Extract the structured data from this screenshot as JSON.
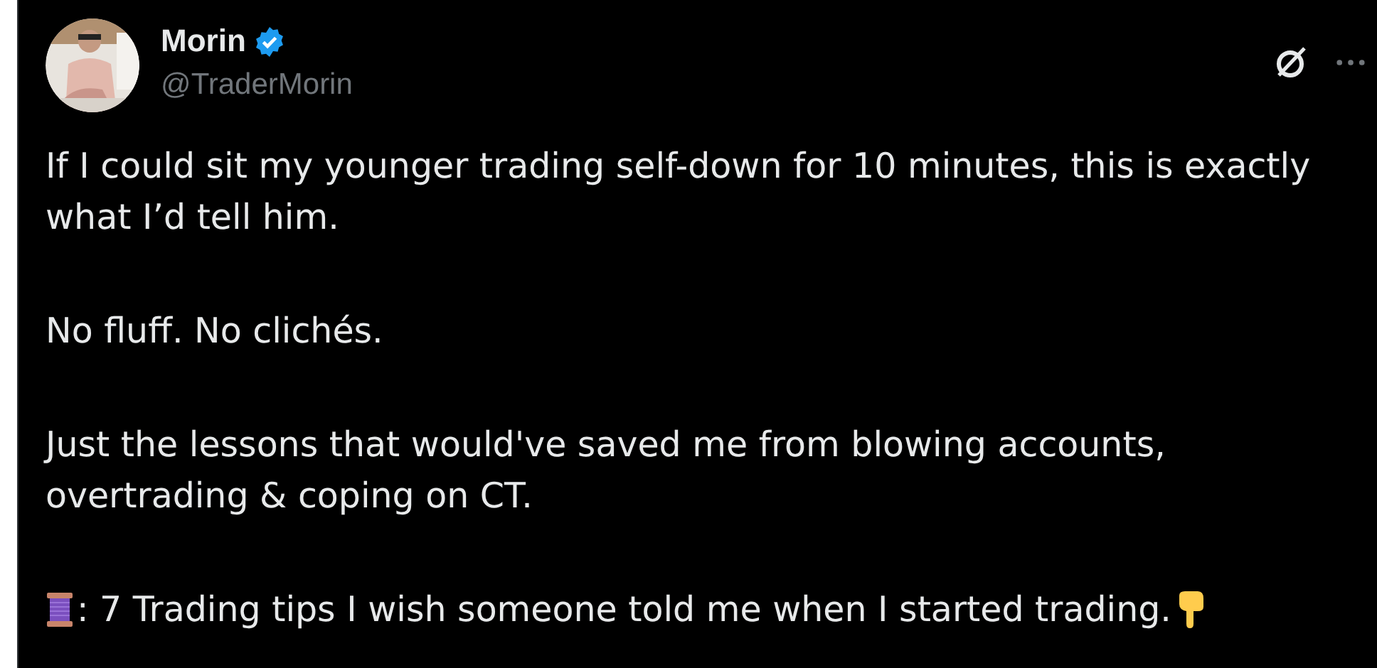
{
  "author": {
    "name": "Morin",
    "verified": true,
    "handle": "@TraderMorin"
  },
  "paragraphs": [
    "If I could sit my younger trading self-down for 10 minutes, this is exactly what I’d tell him.",
    "No fluff. No clichés.",
    "Just the lessons that would've saved me from blowing accounts, overtrading & coping on CT.",
    ": 7 Trading tips I wish someone told me when I started trading."
  ]
}
